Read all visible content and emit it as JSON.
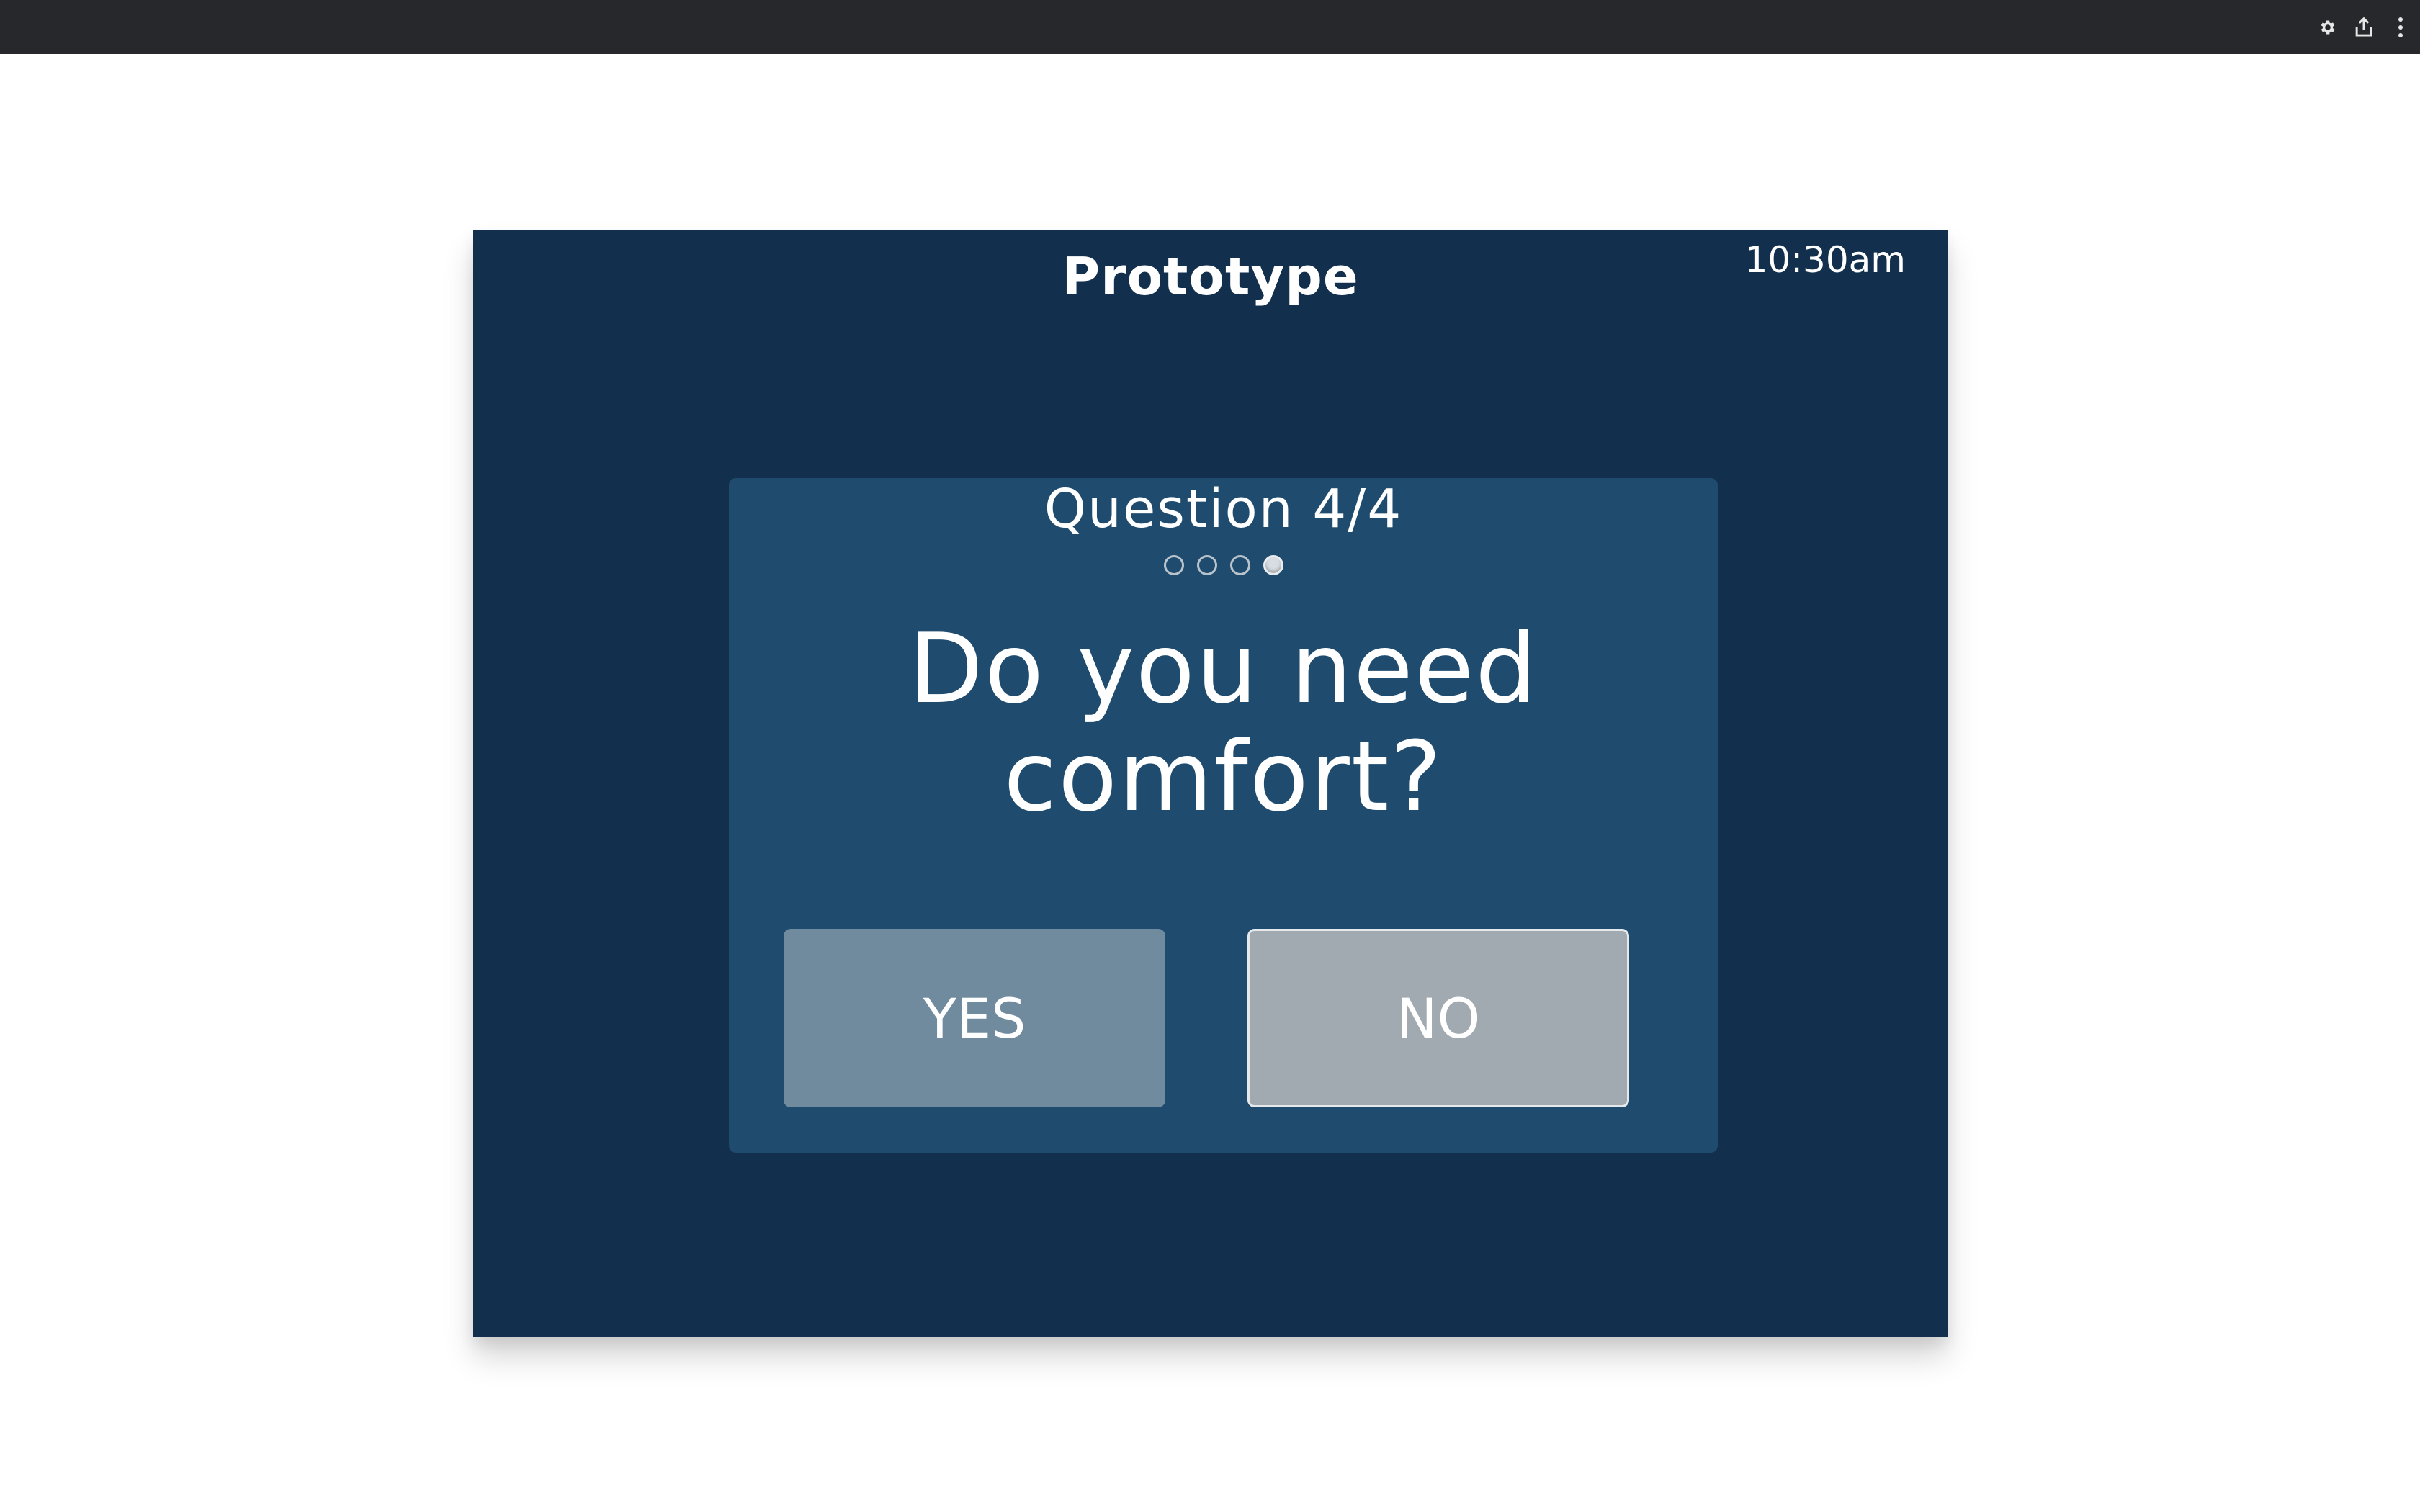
{
  "toolbar": {
    "icons": [
      "gear-icon",
      "share-icon",
      "more-vertical-icon"
    ]
  },
  "app": {
    "title": "Prototype",
    "time": "10:30am"
  },
  "survey": {
    "counter": "Question 4/4",
    "total_questions": 4,
    "current_question": 4,
    "question_line1": "Do you need",
    "question_line2": "comfort?",
    "yes_label": "YES",
    "no_label": "NO"
  },
  "colors": {
    "topbar": "#27282b",
    "device_background": "#12304d",
    "card_background": "#1f4c6e",
    "yes_button": "#718b9e",
    "no_button": "#a1aab0"
  }
}
